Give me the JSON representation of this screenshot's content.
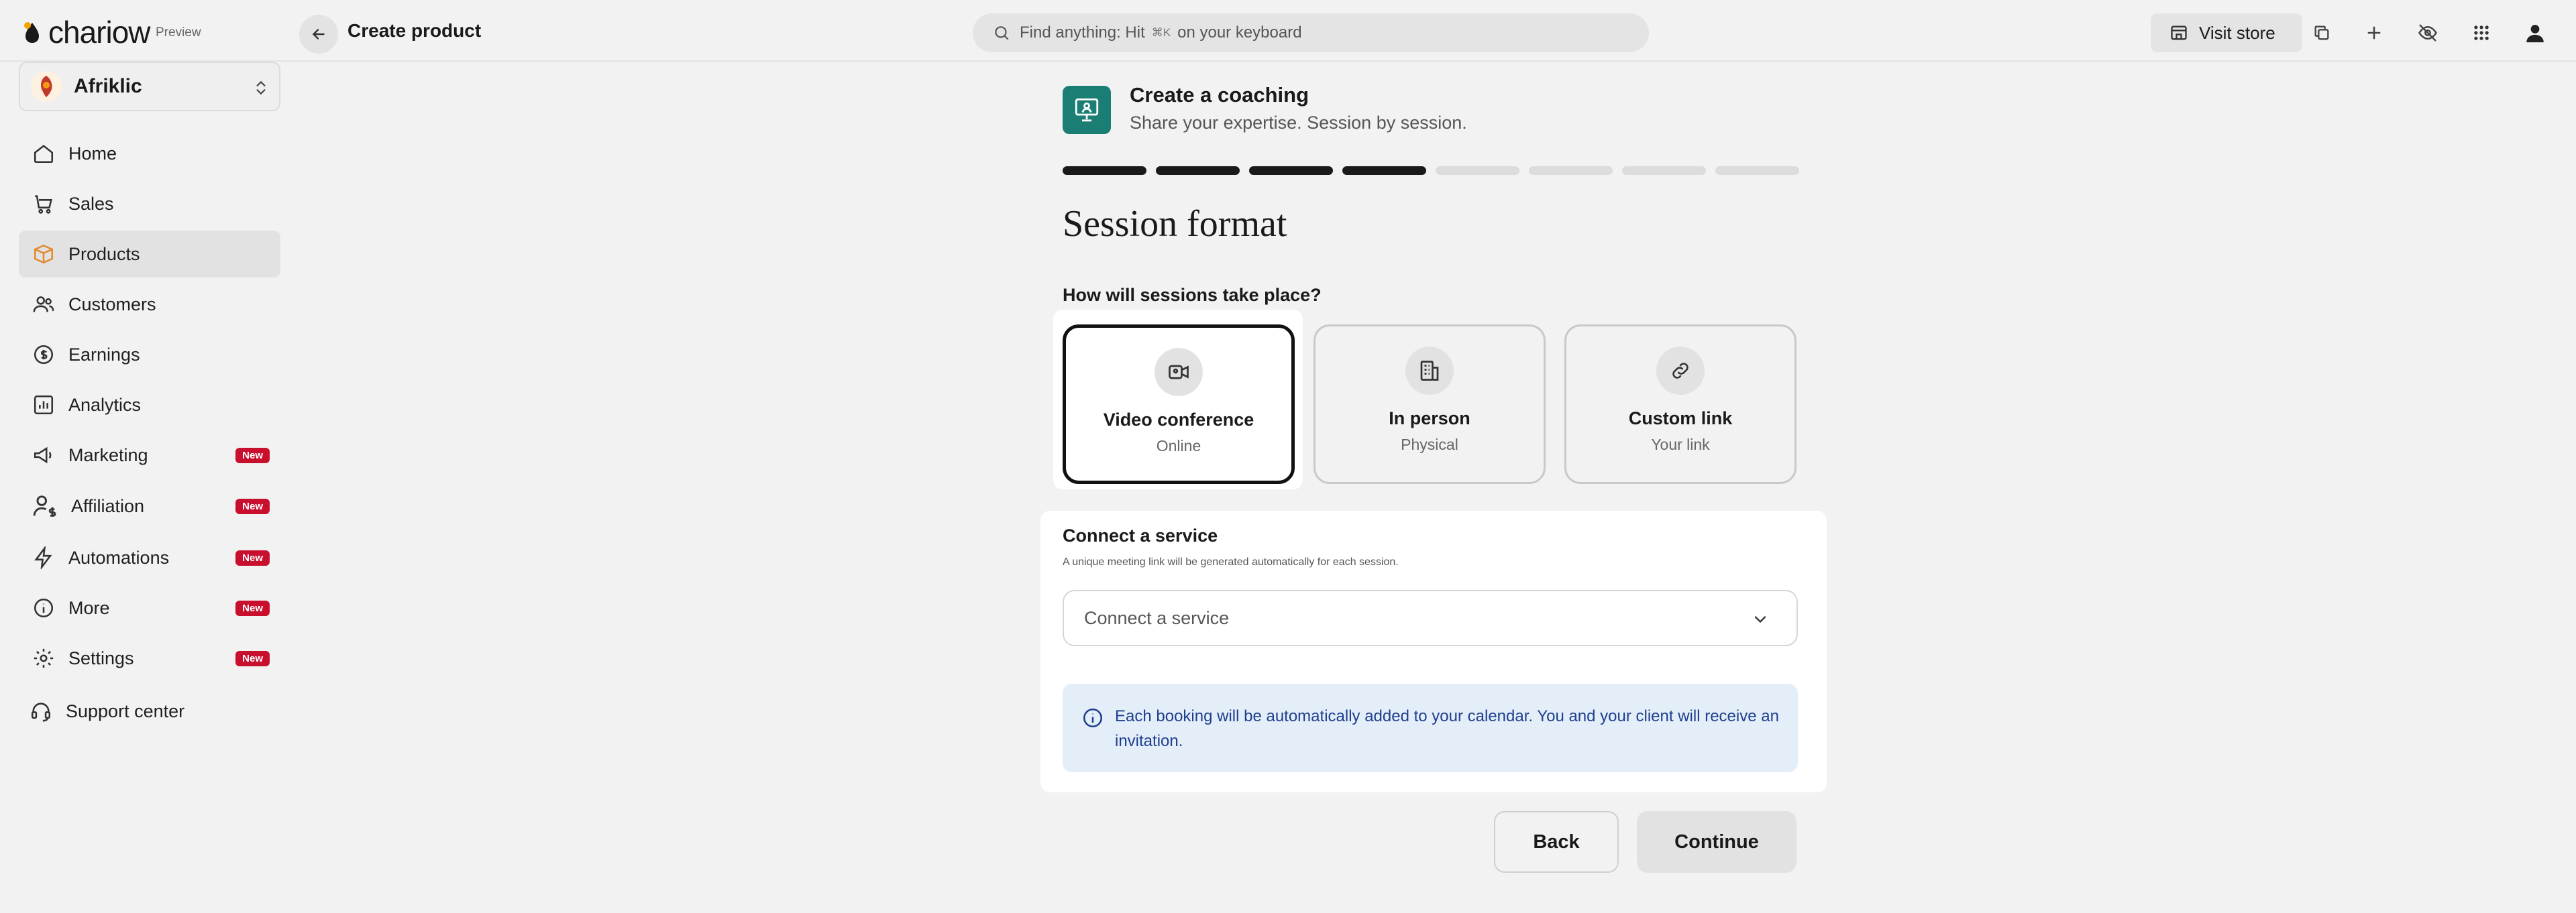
{
  "app": {
    "logo_text": "chariow",
    "preview_label": "Preview"
  },
  "topbar": {
    "title": "Create product",
    "search_prefix": "Find anything: Hit",
    "search_kbd": "⌘K",
    "search_suffix": "on your keyboard",
    "visit_store": "Visit store"
  },
  "sidebar": {
    "store_name": "Afriklic",
    "items": [
      {
        "label": "Home",
        "icon": "home-icon"
      },
      {
        "label": "Sales",
        "icon": "cart-icon"
      },
      {
        "label": "Products",
        "icon": "box-icon",
        "active": true
      },
      {
        "label": "Customers",
        "icon": "users-icon"
      },
      {
        "label": "Earnings",
        "icon": "coins-icon"
      },
      {
        "label": "Analytics",
        "icon": "chart-icon"
      },
      {
        "label": "Marketing",
        "icon": "megaphone-icon",
        "badge": "New"
      },
      {
        "label": "Affiliation",
        "icon": "user-dollar-icon",
        "badge": "New"
      },
      {
        "label": "Automations",
        "icon": "bolt-icon",
        "badge": "New"
      },
      {
        "label": "More",
        "icon": "info-icon",
        "badge": "New"
      },
      {
        "label": "Settings",
        "icon": "gear-icon",
        "badge": "New"
      },
      {
        "label": "Support center",
        "icon": "headset-icon"
      }
    ]
  },
  "header": {
    "title": "Create a coaching",
    "subtitle": "Share your expertise. Session by session."
  },
  "progress": {
    "steps_total": 8,
    "steps_completed": 4
  },
  "page": {
    "heading": "Session format",
    "question": "How will sessions take place?"
  },
  "options": [
    {
      "title": "Video conference",
      "subtitle": "Online",
      "icon": "video-icon",
      "selected": true
    },
    {
      "title": "In person",
      "subtitle": "Physical",
      "icon": "building-icon",
      "selected": false
    },
    {
      "title": "Custom link",
      "subtitle": "Your link",
      "icon": "link-icon",
      "selected": false
    }
  ],
  "connect": {
    "title": "Connect a service",
    "subtitle": "A unique meeting link will be generated automatically for each session.",
    "placeholder": "Connect a service",
    "info": "Each booking will be automatically added to your calendar. You and your client will receive an invitation."
  },
  "actions": {
    "back": "Back",
    "continue": "Continue"
  },
  "colors": {
    "accent": "#1b7e74",
    "badge": "#c8102e",
    "info_bg": "#e4eef8",
    "info_text": "#1e3f8f"
  }
}
